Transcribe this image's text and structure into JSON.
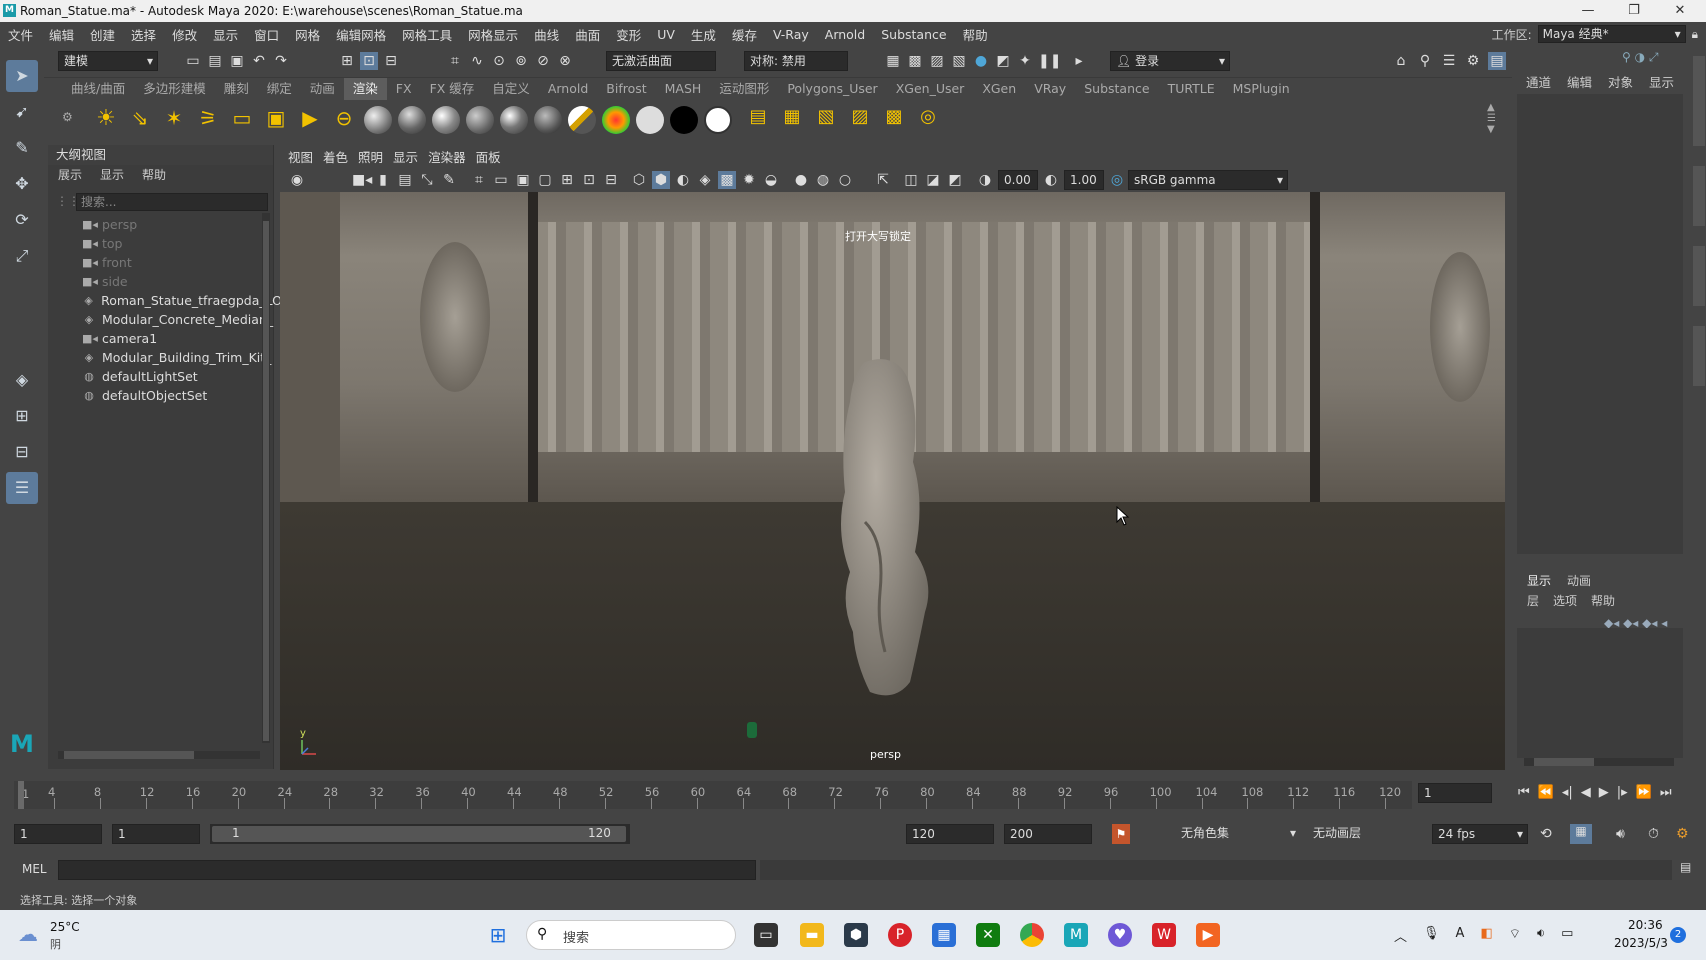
{
  "titlebar": {
    "title": "Roman_Statue.ma* - Autodesk Maya 2020: E:\\warehouse\\scenes\\Roman_Statue.ma",
    "minimize": "—",
    "maximize": "❐",
    "close": "✕"
  },
  "menubar": {
    "items": [
      "文件",
      "编辑",
      "创建",
      "选择",
      "修改",
      "显示",
      "窗口",
      "网格",
      "编辑网格",
      "网格工具",
      "网格显示",
      "曲线",
      "曲面",
      "变形",
      "UV",
      "生成",
      "缓存",
      "V-Ray",
      "Arnold",
      "Substance",
      "帮助"
    ],
    "workspace_label": "工作区:",
    "workspace_value": "Maya 经典*"
  },
  "statusline": {
    "mode": "建模",
    "live_surface": "无激活曲面",
    "symmetry": "对称: 禁用",
    "login": "登录"
  },
  "shelf": {
    "tabs": [
      "曲线/曲面",
      "多边形建模",
      "雕刻",
      "绑定",
      "动画",
      "渲染",
      "FX",
      "FX 缓存",
      "自定义",
      "Arnold",
      "Bifrost",
      "MASH",
      "运动图形",
      "Polygons_User",
      "XGen_User",
      "XGen",
      "VRay",
      "Substance",
      "TURTLE",
      "MSPlugin"
    ],
    "active_tab": "渲染"
  },
  "outliner": {
    "title": "大纲视图",
    "menu": [
      "展示",
      "显示",
      "帮助"
    ],
    "search_placeholder": "搜索...",
    "items": [
      {
        "name": "persp",
        "type": "camera",
        "dim": true
      },
      {
        "name": "top",
        "type": "camera",
        "dim": true
      },
      {
        "name": "front",
        "type": "camera",
        "dim": true
      },
      {
        "name": "side",
        "type": "camera",
        "dim": true
      },
      {
        "name": "Roman_Statue_tfraegpda_LO",
        "type": "mesh",
        "dim": false
      },
      {
        "name": "Modular_Concrete_Median_",
        "type": "mesh",
        "dim": false
      },
      {
        "name": "camera1",
        "type": "camera",
        "dim": false
      },
      {
        "name": "Modular_Building_Trim_Kit_",
        "type": "mesh",
        "dim": false
      },
      {
        "name": "defaultLightSet",
        "type": "set",
        "dim": false
      },
      {
        "name": "defaultObjectSet",
        "type": "set",
        "dim": false
      }
    ]
  },
  "viewport": {
    "menu": [
      "视图",
      "着色",
      "照明",
      "显示",
      "渲染器",
      "面板"
    ],
    "exposure": "0.00",
    "gamma": "1.00",
    "color_space": "sRGB gamma",
    "caps_message": "打开大写锁定",
    "camera_label": "persp",
    "axis_y": "y"
  },
  "rightpanel": {
    "tabs": [
      "通道",
      "编辑",
      "对象",
      "显示"
    ],
    "layer_tabs": [
      "显示",
      "动画"
    ],
    "layer_menu": [
      "层",
      "选项",
      "帮助"
    ]
  },
  "timeline": {
    "ticks": [
      "4",
      "8",
      "12",
      "16",
      "20",
      "24",
      "28",
      "32",
      "36",
      "40",
      "44",
      "48",
      "52",
      "56",
      "60",
      "64",
      "68",
      "72",
      "76",
      "80",
      "84",
      "88",
      "92",
      "96",
      "100",
      "104",
      "108",
      "112",
      "116",
      "120"
    ],
    "first_tick": "1",
    "current_frame": "1"
  },
  "range": {
    "start": "1",
    "playback_start": "1",
    "slider_start": "1",
    "slider_end": "120",
    "playback_end": "120",
    "end": "200",
    "character_set": "无角色集",
    "anim_layer": "无动画层",
    "fps": "24 fps"
  },
  "cmdline": {
    "label": "MEL"
  },
  "helpline": {
    "text": "选择工具: 选择一个对象"
  },
  "taskbar": {
    "weather_temp": "25°C",
    "weather_desc": "阴",
    "search": "搜索",
    "time": "20:36",
    "date": "2023/5/3",
    "notifications": "2"
  }
}
